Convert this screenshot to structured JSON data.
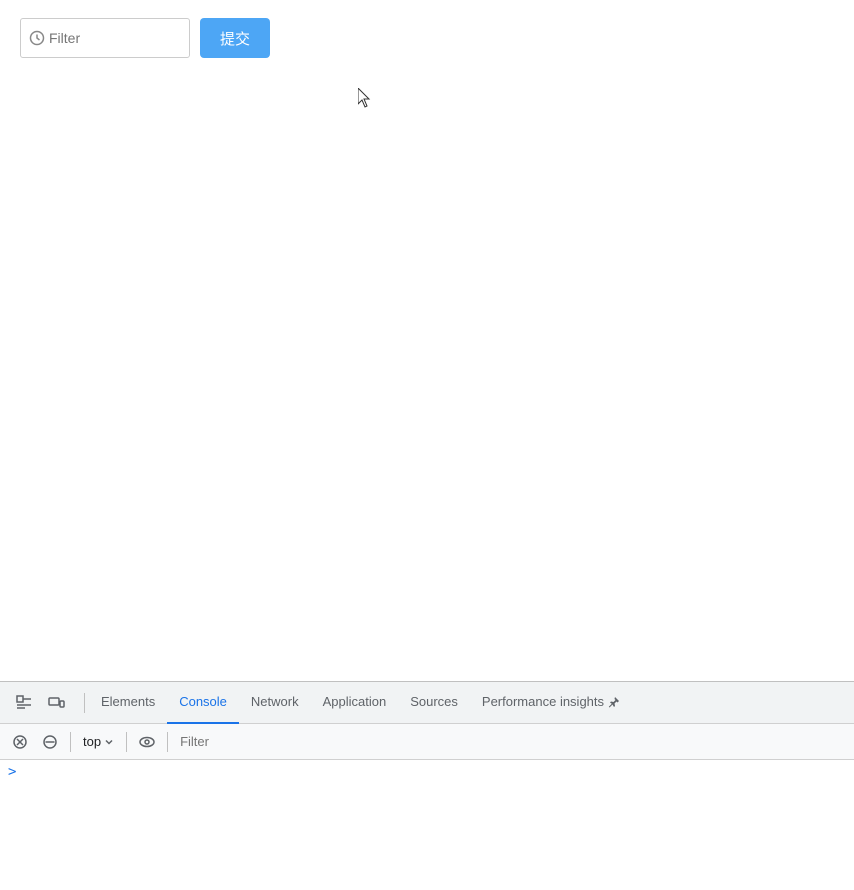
{
  "main": {
    "background": "#ffffff"
  },
  "form": {
    "input_placeholder": "",
    "submit_label": "提交"
  },
  "devtools": {
    "tabs": [
      {
        "id": "elements",
        "label": "Elements",
        "active": false
      },
      {
        "id": "console",
        "label": "Console",
        "active": true
      },
      {
        "id": "network",
        "label": "Network",
        "active": false
      },
      {
        "id": "application",
        "label": "Application",
        "active": false
      },
      {
        "id": "sources",
        "label": "Sources",
        "active": false
      },
      {
        "id": "performance",
        "label": "Performance insights",
        "active": false
      }
    ],
    "toolbar": {
      "context_label": "top",
      "filter_placeholder": "Filter"
    },
    "console_prompt": ">"
  }
}
